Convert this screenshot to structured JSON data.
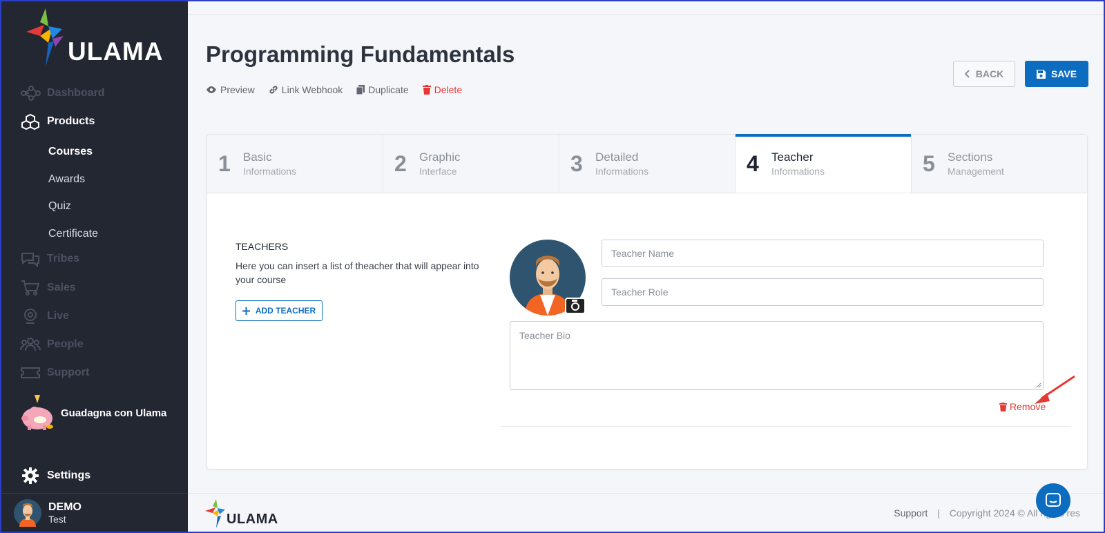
{
  "brand": {
    "name": "ULAMA",
    "accent": "#0c6cc0",
    "danger": "#e53935"
  },
  "sidebar": {
    "items": [
      {
        "label": "Dashboard",
        "icon": "network-icon"
      },
      {
        "label": "Products",
        "icon": "boxes-icon"
      },
      {
        "label": "Tribes",
        "icon": "chat-bubbles-icon"
      },
      {
        "label": "Sales",
        "icon": "cart-icon"
      },
      {
        "label": "Live",
        "icon": "webcam-icon"
      },
      {
        "label": "People",
        "icon": "people-icon"
      },
      {
        "label": "Support",
        "icon": "ticket-icon"
      }
    ],
    "products_sub": [
      "Courses",
      "Awards",
      "Quiz",
      "Certificate"
    ],
    "promo_label": "Guadagna con Ulama",
    "settings_label": "Settings",
    "user": {
      "name": "DEMO",
      "sub": "Test"
    }
  },
  "page": {
    "title": "Programming Fundamentals",
    "actions": {
      "preview": "Preview",
      "webhook": "Link Webhook",
      "duplicate": "Duplicate",
      "delete": "Delete"
    },
    "back_label": "BACK",
    "save_label": "SAVE"
  },
  "tabs": [
    {
      "num": "1",
      "title": "Basic",
      "sub": "Informations"
    },
    {
      "num": "2",
      "title": "Graphic",
      "sub": "Interface"
    },
    {
      "num": "3",
      "title": "Detailed",
      "sub": "Informations"
    },
    {
      "num": "4",
      "title": "Teacher",
      "sub": "Informations"
    },
    {
      "num": "5",
      "title": "Sections",
      "sub": "Management"
    }
  ],
  "teachers": {
    "title": "TEACHERS",
    "description": "Here you can insert a list of theacher that will appear into your course",
    "add_label": "ADD TEACHER",
    "name_placeholder": "Teacher Name",
    "role_placeholder": "Teacher Role",
    "bio_placeholder": "Teacher Bio",
    "remove_label": "Remove"
  },
  "footer": {
    "logo": "ULAMA",
    "support": "Support",
    "separator": "|",
    "copyright": "Copyright 2024 © All rights res"
  }
}
